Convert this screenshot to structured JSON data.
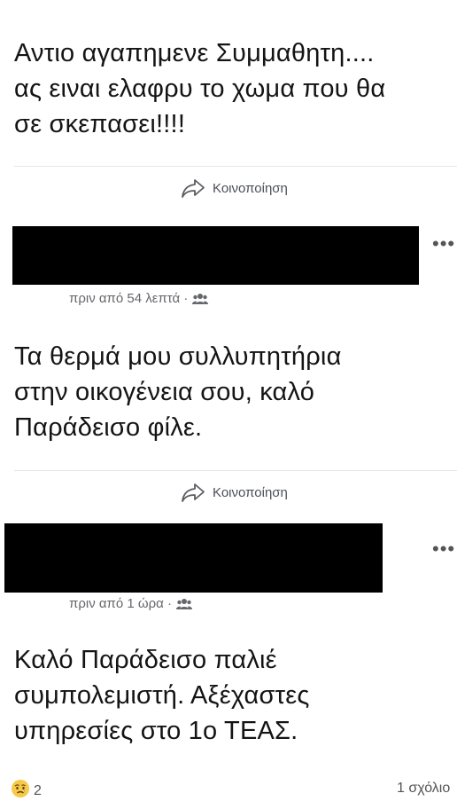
{
  "posts": [
    {
      "text": "Αντιο αγαπημενε Συμμαθητη....\nας ειναι ελαφρυ το χωμα που θα\nσε σκεπασει!!!!",
      "share_label": "Κοινοποίηση"
    },
    {
      "time": "πριν από 54 λεπτά · ",
      "text": "Τα θερμά μου συλλυπητήρια\nστην οικογένεια σου, καλό\nΠαράδεισο φίλε.",
      "share_label": "Κοινοποίηση"
    },
    {
      "time": "πριν από 1 ώρα · ",
      "text": "Καλό Παράδεισο παλιέ\nσυμπολεμιστή. Αξέχαστες\nυπηρεσίες στο 1ο ΤΕΑΣ."
    }
  ],
  "more_label": "•••",
  "footer": {
    "reaction_count": "2",
    "comments_label": "1 σχόλιο"
  },
  "icons": [
    "share-icon",
    "group-icon",
    "more-icon",
    "sad-reaction-icon"
  ]
}
